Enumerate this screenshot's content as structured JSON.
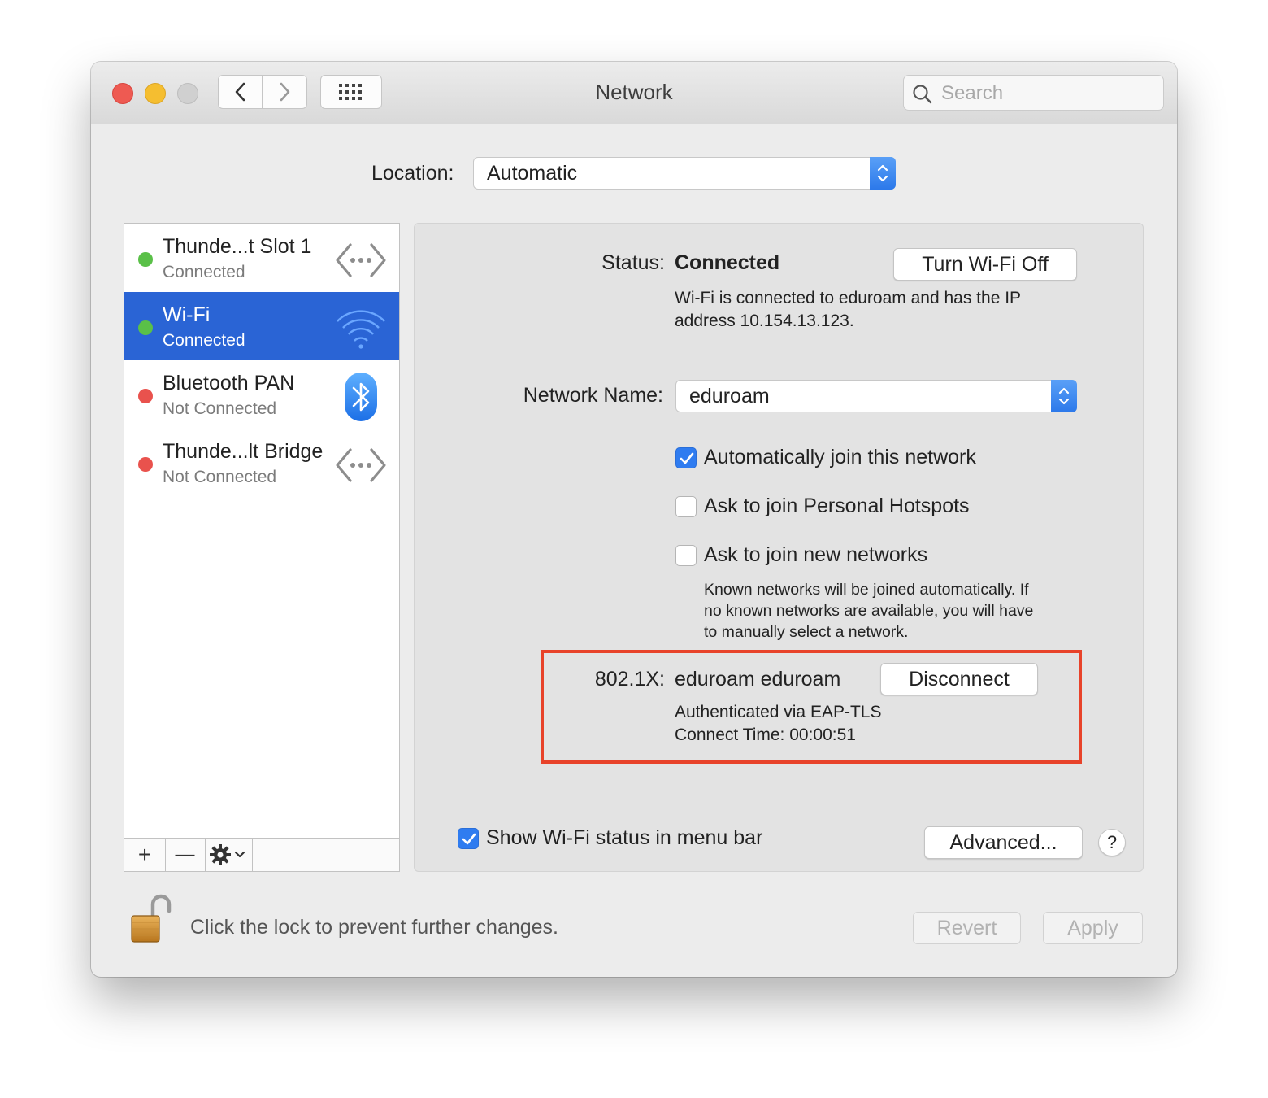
{
  "window": {
    "title": "Network"
  },
  "toolbar": {
    "search_placeholder": "Search"
  },
  "location": {
    "label": "Location:",
    "value": "Automatic"
  },
  "services": [
    {
      "name": "Thunde...t Slot  1",
      "status": "Connected",
      "indicator": "green",
      "icon": "ethernet-icon",
      "selected": false
    },
    {
      "name": "Wi-Fi",
      "status": "Connected",
      "indicator": "green",
      "icon": "wifi-icon",
      "selected": true
    },
    {
      "name": "Bluetooth PAN",
      "status": "Not Connected",
      "indicator": "red",
      "icon": "bluetooth-icon",
      "selected": false
    },
    {
      "name": "Thunde...lt Bridge",
      "status": "Not Connected",
      "indicator": "red",
      "icon": "ethernet-icon",
      "selected": false
    }
  ],
  "sidebar_actions": {
    "add": "+",
    "remove": "—"
  },
  "detail": {
    "status_label": "Status:",
    "status_value": "Connected",
    "turn_off_button": "Turn Wi-Fi Off",
    "status_desc_1": "Wi-Fi is connected to eduroam and has the IP",
    "status_desc_2": "address 10.154.13.123.",
    "network_name_label": "Network Name:",
    "network_name_value": "eduroam",
    "checkboxes": [
      {
        "label": "Automatically join this network",
        "checked": true
      },
      {
        "label": "Ask to join Personal Hotspots",
        "checked": false
      },
      {
        "label": "Ask to join new networks",
        "checked": false
      }
    ],
    "note_lines": [
      "Known networks will be joined automatically. If",
      "no known networks are available, you will have",
      "to manually select a network."
    ],
    "dot1x_label": "802.1X:",
    "dot1x_value": "eduroam eduroam",
    "disconnect_button": "Disconnect",
    "auth_text": "Authenticated via EAP-TLS",
    "connect_time": "Connect Time: 00:00:51",
    "show_status_label": "Show Wi-Fi status in menu bar",
    "show_status_checked": true,
    "advanced_button": "Advanced...",
    "help_button": "?"
  },
  "footer": {
    "lock_text": "Click the lock to prevent further changes.",
    "revert_button": "Revert",
    "apply_button": "Apply"
  },
  "colors": {
    "selection": "#2a64d5",
    "checkbox_on": "#2f7cf0",
    "highlight_border": "#e8432a",
    "status_green": "#5ac048",
    "status_red": "#e9524d"
  }
}
